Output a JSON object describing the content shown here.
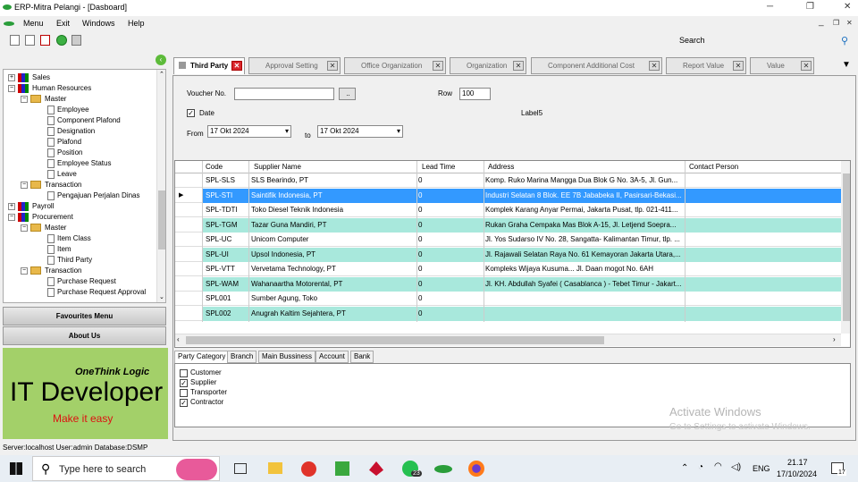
{
  "window": {
    "title": "ERP-Mitra Pelangi - [Dasboard]"
  },
  "menu": {
    "items": [
      "Menu",
      "Exit",
      "Windows",
      "Help"
    ]
  },
  "toolbar": {
    "search_label": "Search"
  },
  "tree": {
    "nodes": [
      "Sales",
      "Human Resources",
      "Master",
      "Employee",
      "Component Plafond",
      "Designation",
      "Plafond",
      "Position",
      "Employee Status",
      "Leave",
      "Transaction",
      "Pengajuan Perjalan Dinas",
      "Payroll",
      "Procurement",
      "Master",
      "Item Class",
      "Item",
      "Third Party",
      "Transaction",
      "Purchase Request",
      "Purchase Request Approval"
    ]
  },
  "left_buttons": {
    "favourites": "Favourites Menu",
    "about": "About Us"
  },
  "banner": {
    "company": "OneThink Logic",
    "title": "IT Developer",
    "tagline": "Make it easy"
  },
  "status": "Server:localhost  User:admin  Database:DSMP",
  "tabs": [
    "Third Party",
    "Approval Setting",
    "Office Organization",
    "Organization",
    "Component Additional Cost",
    "Report Value",
    "Value"
  ],
  "form": {
    "voucher_label": "Voucher No.",
    "voucher_value": "",
    "browse_label": "..",
    "row_label": "Row",
    "row_value": "100",
    "date_label": "Date",
    "label5": "Label5",
    "from_label": "From",
    "from_value": "17 Okt  2024",
    "to_label": "to",
    "to_value": "17 Okt  2024"
  },
  "grid": {
    "columns": [
      "Code",
      "Supplier Name",
      "Lead Time",
      "Address",
      "Contact Person"
    ],
    "rows": [
      [
        "SPL-SLS",
        "SLS Bearindo, PT",
        "0",
        "Komp. Ruko Marina Mangga Dua Blok G No. 3A-5, Jl. Gun..."
      ],
      [
        "SPL-STI",
        "Saintifik Indonesia, PT",
        "0",
        "Industri Selatan 8 Blok. EE 7B Jababeka II, Pasirsari-Bekasi..."
      ],
      [
        "SPL-TDTI",
        "Toko Diesel Teknik Indonesia",
        "0",
        "Komplek Karang Anyar Permai,  Jakarta Pusat, tlp. 021-411..."
      ],
      [
        "SPL-TGM",
        "Tazar Guna Mandiri, PT",
        "0",
        "Rukan Graha Cempaka Mas Blok A-15,  Jl. Letjend Soepra..."
      ],
      [
        "SPL-UC",
        "Unicom Computer",
        "0",
        "Jl. Yos Sudarso IV No. 28, Sangatta- Kalimantan Timur, tlp. ..."
      ],
      [
        "SPL-UI",
        "Upsol Indonesia, PT",
        "0",
        "Jl. Rajawali Selatan Raya No. 61 Kemayoran Jakarta Utara,..."
      ],
      [
        "SPL-VTT",
        "Vervetama Technology, PT",
        "0",
        "Kompleks Wijaya Kusuma... Jl. Daan mogot No. 6AH"
      ],
      [
        "SPL-WAM",
        "Wahanaartha Motorental, PT",
        "0",
        "Jl. KH. Abdullah Syafei ( Casablanca ) - Tebet Timur - Jakart..."
      ],
      [
        "SPL001",
        "Sumber Agung, Toko",
        "0",
        ""
      ],
      [
        "SPL002",
        "Anugrah Kaltim Sejahtera, PT",
        "0",
        ""
      ]
    ]
  },
  "subtabs": [
    "Party Category",
    "Branch",
    "Main Bussiness",
    "Account",
    "Bank"
  ],
  "categories": [
    {
      "label": "Customer",
      "checked": false
    },
    {
      "label": "Supplier",
      "checked": true
    },
    {
      "label": "Transporter",
      "checked": false
    },
    {
      "label": "Contractor",
      "checked": true
    }
  ],
  "watermark": {
    "title": "Activate Windows",
    "sub": "Go to Settings to activate Windows."
  },
  "taskbar": {
    "search": "Type here to search",
    "lang": "ENG",
    "time": "21.17",
    "date": "17/10/2024",
    "badge_whatsapp": "23",
    "badge_notif": "17"
  },
  "colors": {
    "selected": "#3399ff",
    "alt_row": "#a8e8dc",
    "banner": "#a3d069"
  }
}
